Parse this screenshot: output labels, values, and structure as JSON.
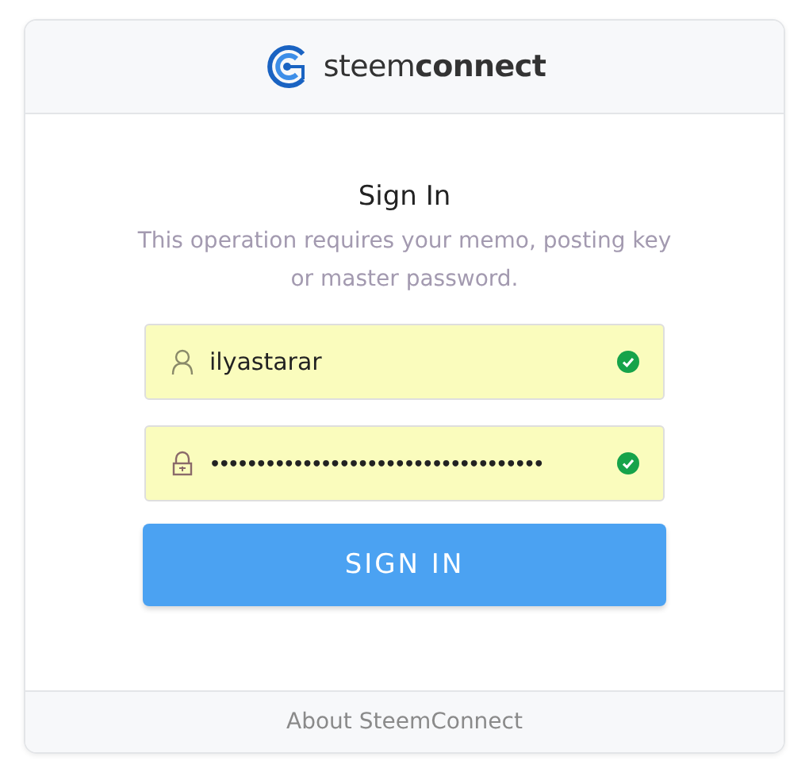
{
  "header": {
    "logo_text": "steem**connect**"
  },
  "form": {
    "title": "Sign In",
    "subtitle": "This operation requires your memo, posting key or master password.",
    "fields": [
      {
        "kind": "user",
        "value": "ilyastarar",
        "valid": true
      },
      {
        "kind": "lock",
        "value": "••••••••••••••••••••••••••••••••••••",
        "valid": true
      }
    ],
    "submit": "SIGN IN"
  },
  "footer": {
    "link": "About SteemConnect"
  }
}
